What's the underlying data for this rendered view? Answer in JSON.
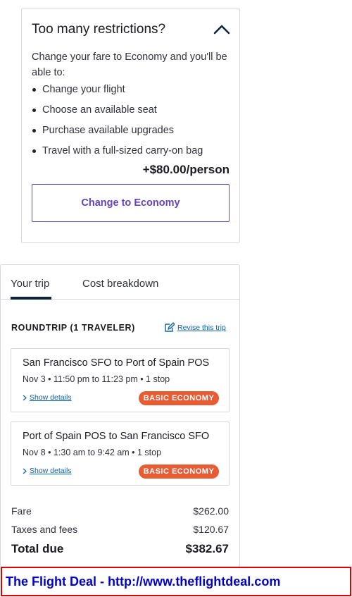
{
  "restrictions": {
    "title": "Too many restrictions?",
    "description": "Change your fare to Economy and you'll be able to:",
    "benefits": [
      "Change your flight",
      "Choose an available seat",
      "Purchase available upgrades",
      "Travel with a full-sized carry-on bag"
    ],
    "price_per_person": "+$80.00/person",
    "button_label": "Change to Economy",
    "accent_color": "#6244bb"
  },
  "trip": {
    "tabs": [
      {
        "label": "Your trip",
        "selected": true
      },
      {
        "label": "Cost breakdown",
        "selected": false
      }
    ],
    "summary_heading": "ROUNDTRIP (1 TRAVELER)",
    "revise_link": "Revise this trip",
    "flights": [
      {
        "route": "San Francisco SFO to Port of Spain POS",
        "times": "Nov 3 • 11:50 pm to 11:23 pm • 1 stop",
        "details_link": "Show details",
        "fare_class": "BASIC ECONOMY"
      },
      {
        "route": "Port of Spain POS to San Francisco SFO",
        "times": "Nov 8 • 1:30 am to 9:42 am • 1 stop",
        "details_link": "Show details",
        "fare_class": "BASIC ECONOMY"
      }
    ],
    "costs": {
      "fare_label": "Fare",
      "fare_value": "$262.00",
      "taxes_label": "Taxes and fees",
      "taxes_value": "$120.67",
      "total_label": "Total due",
      "total_value": "$382.67"
    },
    "badge_color": "#e85c34"
  },
  "footer": {
    "text": "The Flight Deal - http://www.theflightdeal.com"
  }
}
